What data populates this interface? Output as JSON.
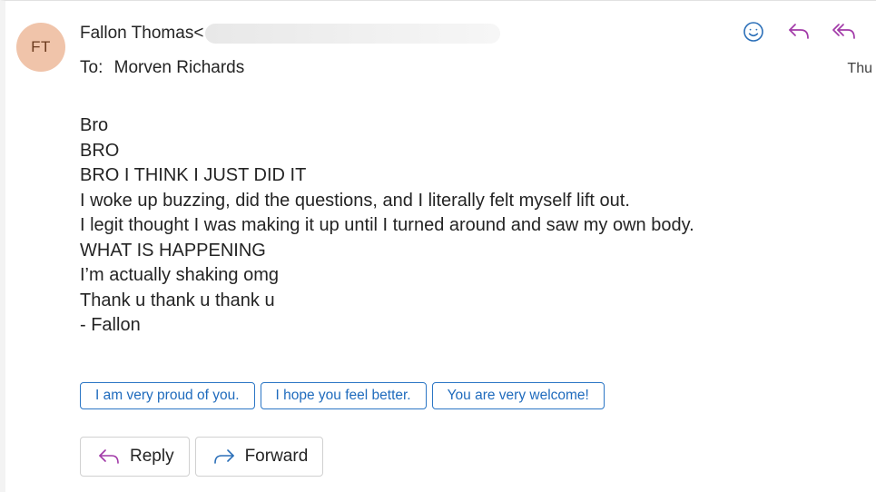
{
  "sender": {
    "initials": "FT",
    "name_prefix": "Fallon Thomas<"
  },
  "recipient": {
    "label": "To:",
    "name": "Morven Richards"
  },
  "date": "Thu",
  "message": {
    "lines": [
      "Bro",
      "BRO",
      "BRO I THINK I JUST DID IT",
      "I woke up buzzing, did the questions, and I literally felt myself lift out.",
      "I legit thought I was making it up until I turned around and saw my own body.",
      "WHAT IS HAPPENING",
      "I’m actually shaking omg",
      "Thank u thank u thank u",
      "- Fallon"
    ]
  },
  "suggested_replies": [
    "I am very proud of you.",
    "I hope you feel better.",
    "You are very welcome!"
  ],
  "buttons": {
    "reply_label": "Reply",
    "forward_label": "Forward"
  },
  "icons": {
    "emoji": "smiley-icon",
    "reply": "reply-arrow-icon",
    "reply_all": "reply-all-icon",
    "forward": "forward-arrow-icon"
  },
  "colors": {
    "accent": "#2b76c5",
    "action_icons": "#a23aa8",
    "avatar_bg": "#f0c4aa"
  }
}
